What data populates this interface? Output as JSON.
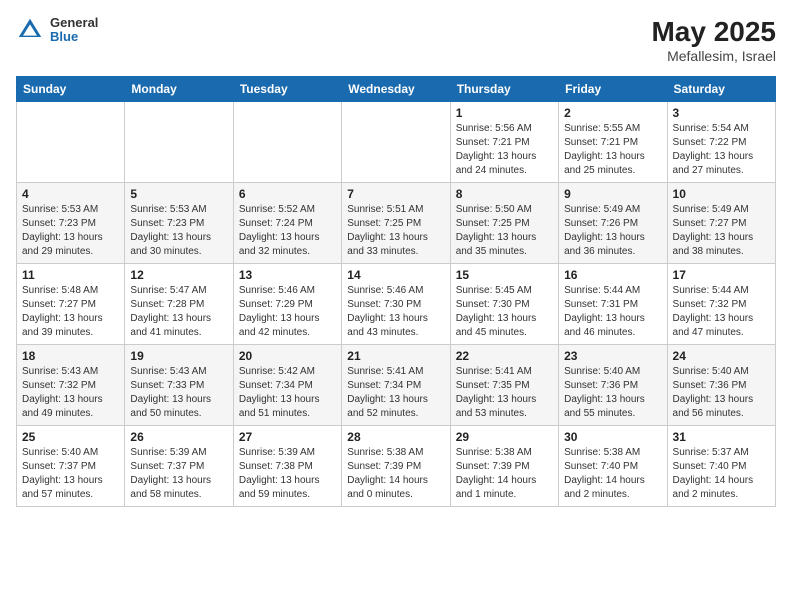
{
  "header": {
    "logo": {
      "general": "General",
      "blue": "Blue"
    },
    "title": "May 2025",
    "location": "Mefallesim, Israel"
  },
  "weekdays": [
    "Sunday",
    "Monday",
    "Tuesday",
    "Wednesday",
    "Thursday",
    "Friday",
    "Saturday"
  ],
  "weeks": [
    [
      {
        "day": "",
        "info": ""
      },
      {
        "day": "",
        "info": ""
      },
      {
        "day": "",
        "info": ""
      },
      {
        "day": "",
        "info": ""
      },
      {
        "day": "1",
        "info": "Sunrise: 5:56 AM\nSunset: 7:21 PM\nDaylight: 13 hours\nand 24 minutes."
      },
      {
        "day": "2",
        "info": "Sunrise: 5:55 AM\nSunset: 7:21 PM\nDaylight: 13 hours\nand 25 minutes."
      },
      {
        "day": "3",
        "info": "Sunrise: 5:54 AM\nSunset: 7:22 PM\nDaylight: 13 hours\nand 27 minutes."
      }
    ],
    [
      {
        "day": "4",
        "info": "Sunrise: 5:53 AM\nSunset: 7:23 PM\nDaylight: 13 hours\nand 29 minutes."
      },
      {
        "day": "5",
        "info": "Sunrise: 5:53 AM\nSunset: 7:23 PM\nDaylight: 13 hours\nand 30 minutes."
      },
      {
        "day": "6",
        "info": "Sunrise: 5:52 AM\nSunset: 7:24 PM\nDaylight: 13 hours\nand 32 minutes."
      },
      {
        "day": "7",
        "info": "Sunrise: 5:51 AM\nSunset: 7:25 PM\nDaylight: 13 hours\nand 33 minutes."
      },
      {
        "day": "8",
        "info": "Sunrise: 5:50 AM\nSunset: 7:25 PM\nDaylight: 13 hours\nand 35 minutes."
      },
      {
        "day": "9",
        "info": "Sunrise: 5:49 AM\nSunset: 7:26 PM\nDaylight: 13 hours\nand 36 minutes."
      },
      {
        "day": "10",
        "info": "Sunrise: 5:49 AM\nSunset: 7:27 PM\nDaylight: 13 hours\nand 38 minutes."
      }
    ],
    [
      {
        "day": "11",
        "info": "Sunrise: 5:48 AM\nSunset: 7:27 PM\nDaylight: 13 hours\nand 39 minutes."
      },
      {
        "day": "12",
        "info": "Sunrise: 5:47 AM\nSunset: 7:28 PM\nDaylight: 13 hours\nand 41 minutes."
      },
      {
        "day": "13",
        "info": "Sunrise: 5:46 AM\nSunset: 7:29 PM\nDaylight: 13 hours\nand 42 minutes."
      },
      {
        "day": "14",
        "info": "Sunrise: 5:46 AM\nSunset: 7:30 PM\nDaylight: 13 hours\nand 43 minutes."
      },
      {
        "day": "15",
        "info": "Sunrise: 5:45 AM\nSunset: 7:30 PM\nDaylight: 13 hours\nand 45 minutes."
      },
      {
        "day": "16",
        "info": "Sunrise: 5:44 AM\nSunset: 7:31 PM\nDaylight: 13 hours\nand 46 minutes."
      },
      {
        "day": "17",
        "info": "Sunrise: 5:44 AM\nSunset: 7:32 PM\nDaylight: 13 hours\nand 47 minutes."
      }
    ],
    [
      {
        "day": "18",
        "info": "Sunrise: 5:43 AM\nSunset: 7:32 PM\nDaylight: 13 hours\nand 49 minutes."
      },
      {
        "day": "19",
        "info": "Sunrise: 5:43 AM\nSunset: 7:33 PM\nDaylight: 13 hours\nand 50 minutes."
      },
      {
        "day": "20",
        "info": "Sunrise: 5:42 AM\nSunset: 7:34 PM\nDaylight: 13 hours\nand 51 minutes."
      },
      {
        "day": "21",
        "info": "Sunrise: 5:41 AM\nSunset: 7:34 PM\nDaylight: 13 hours\nand 52 minutes."
      },
      {
        "day": "22",
        "info": "Sunrise: 5:41 AM\nSunset: 7:35 PM\nDaylight: 13 hours\nand 53 minutes."
      },
      {
        "day": "23",
        "info": "Sunrise: 5:40 AM\nSunset: 7:36 PM\nDaylight: 13 hours\nand 55 minutes."
      },
      {
        "day": "24",
        "info": "Sunrise: 5:40 AM\nSunset: 7:36 PM\nDaylight: 13 hours\nand 56 minutes."
      }
    ],
    [
      {
        "day": "25",
        "info": "Sunrise: 5:40 AM\nSunset: 7:37 PM\nDaylight: 13 hours\nand 57 minutes."
      },
      {
        "day": "26",
        "info": "Sunrise: 5:39 AM\nSunset: 7:37 PM\nDaylight: 13 hours\nand 58 minutes."
      },
      {
        "day": "27",
        "info": "Sunrise: 5:39 AM\nSunset: 7:38 PM\nDaylight: 13 hours\nand 59 minutes."
      },
      {
        "day": "28",
        "info": "Sunrise: 5:38 AM\nSunset: 7:39 PM\nDaylight: 14 hours\nand 0 minutes."
      },
      {
        "day": "29",
        "info": "Sunrise: 5:38 AM\nSunset: 7:39 PM\nDaylight: 14 hours\nand 1 minute."
      },
      {
        "day": "30",
        "info": "Sunrise: 5:38 AM\nSunset: 7:40 PM\nDaylight: 14 hours\nand 2 minutes."
      },
      {
        "day": "31",
        "info": "Sunrise: 5:37 AM\nSunset: 7:40 PM\nDaylight: 14 hours\nand 2 minutes."
      }
    ]
  ]
}
